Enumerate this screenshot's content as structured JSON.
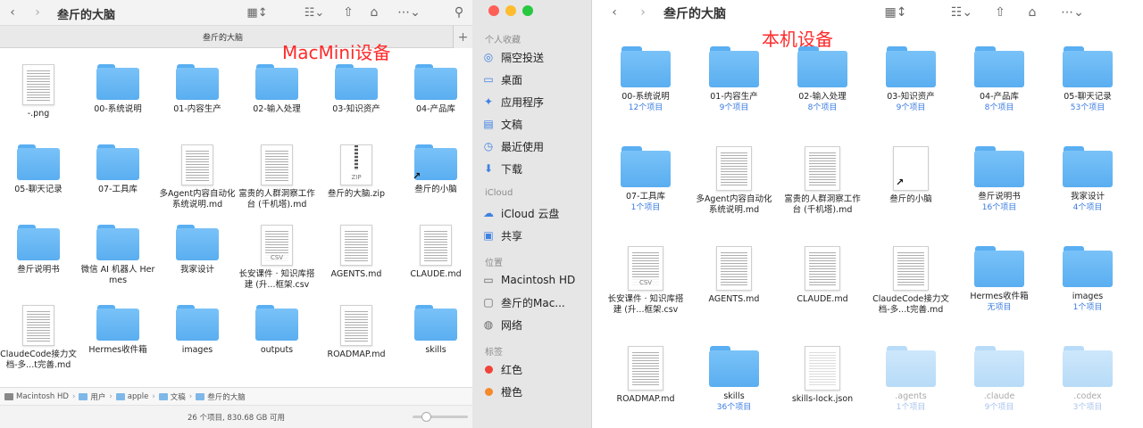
{
  "left_window": {
    "title": "叁斤的大脑",
    "tab_title": "叁斤的大脑",
    "annotation": "MacMini设备",
    "items": [
      {
        "label": "-.png",
        "kind": "doc"
      },
      {
        "label": "00-系统说明",
        "kind": "folder"
      },
      {
        "label": "01-内容生产",
        "kind": "folder"
      },
      {
        "label": "02-输入处理",
        "kind": "folder"
      },
      {
        "label": "03-知识资产",
        "kind": "folder"
      },
      {
        "label": "04-产品库",
        "kind": "folder"
      },
      {
        "label": "05-聊天记录",
        "kind": "folder"
      },
      {
        "label": "07-工具库",
        "kind": "folder"
      },
      {
        "label": "多Agent内容自动化系统说明.md",
        "kind": "doc"
      },
      {
        "label": "富贵的人群洞察工作台 (千机塔).md",
        "kind": "doc"
      },
      {
        "label": "叁斤的大脑.zip",
        "kind": "zip",
        "badge": "ZIP"
      },
      {
        "label": "叁斤的小脑",
        "kind": "alias-folder"
      },
      {
        "label": "叁斤说明书",
        "kind": "folder"
      },
      {
        "label": "微信 AI 机器人 Hermes",
        "kind": "folder"
      },
      {
        "label": "我家设计",
        "kind": "folder"
      },
      {
        "label": "长安课件 · 知识库搭建 (升...框架.csv",
        "kind": "csv",
        "badge": "CSV"
      },
      {
        "label": "AGENTS.md",
        "kind": "doc"
      },
      {
        "label": "CLAUDE.md",
        "kind": "doc"
      },
      {
        "label": "ClaudeCode接力文档-多...t完善.md",
        "kind": "doc"
      },
      {
        "label": "Hermes收件箱",
        "kind": "folder"
      },
      {
        "label": "images",
        "kind": "folder"
      },
      {
        "label": "outputs",
        "kind": "folder"
      },
      {
        "label": "ROADMAP.md",
        "kind": "doc"
      },
      {
        "label": "skills",
        "kind": "folder"
      }
    ],
    "path": [
      "Macintosh HD",
      "用户",
      "apple",
      "文稿",
      "叁斤的大脑"
    ],
    "status": "26 个项目, 830.68 GB 可用"
  },
  "sidebar": {
    "sections": [
      {
        "title": "个人收藏",
        "items": [
          {
            "label": "隔空投送",
            "icon": "airdrop-icon"
          },
          {
            "label": "桌面",
            "icon": "desktop-icon"
          },
          {
            "label": "应用程序",
            "icon": "applications-icon"
          },
          {
            "label": "文稿",
            "icon": "document-icon"
          },
          {
            "label": "最近使用",
            "icon": "clock-icon"
          },
          {
            "label": "下载",
            "icon": "download-icon"
          }
        ]
      },
      {
        "title": "iCloud",
        "items": [
          {
            "label": "iCloud 云盘",
            "icon": "cloud-icon"
          },
          {
            "label": "共享",
            "icon": "shared-folder-icon"
          }
        ]
      },
      {
        "title": "位置",
        "items": [
          {
            "label": "Macintosh HD",
            "icon": "disk-icon"
          },
          {
            "label": "叁斤的Mac...",
            "icon": "display-icon"
          },
          {
            "label": "网络",
            "icon": "network-icon"
          }
        ]
      },
      {
        "title": "标签",
        "items": [
          {
            "label": "红色",
            "icon": "tag-dot-icon",
            "color": "#f0433a"
          },
          {
            "label": "橙色",
            "icon": "tag-dot-icon",
            "color": "#f5892b"
          }
        ]
      }
    ]
  },
  "right_window": {
    "title": "叁斤的大脑",
    "annotation": "本机设备",
    "items": [
      {
        "label": "00-系统说明",
        "sub": "12个项目",
        "kind": "folder"
      },
      {
        "label": "01-内容生产",
        "sub": "9个项目",
        "kind": "folder"
      },
      {
        "label": "02-输入处理",
        "sub": "8个项目",
        "kind": "folder"
      },
      {
        "label": "03-知识资产",
        "sub": "9个项目",
        "kind": "folder"
      },
      {
        "label": "04-产品库",
        "sub": "8个项目",
        "kind": "folder"
      },
      {
        "label": "05-聊天记录",
        "sub": "53个项目",
        "kind": "folder"
      },
      {
        "label": "07-工具库",
        "sub": "1个项目",
        "kind": "folder"
      },
      {
        "label": "多Agent内容自动化系统说明.md",
        "sub": "",
        "kind": "doc"
      },
      {
        "label": "富贵的人群洞察工作台 (千机塔).md",
        "sub": "",
        "kind": "doc"
      },
      {
        "label": "叁斤的小脑",
        "sub": "",
        "kind": "alias-blank"
      },
      {
        "label": "叁斤说明书",
        "sub": "16个项目",
        "kind": "folder"
      },
      {
        "label": "我家设计",
        "sub": "4个项目",
        "kind": "folder"
      },
      {
        "label": "长安课件 · 知识库搭建 (升...框架.csv",
        "sub": "",
        "kind": "csv",
        "badge": "CSV"
      },
      {
        "label": "AGENTS.md",
        "sub": "",
        "kind": "doc"
      },
      {
        "label": "CLAUDE.md",
        "sub": "",
        "kind": "doc"
      },
      {
        "label": "ClaudeCode接力文档-多...t完善.md",
        "sub": "",
        "kind": "doc"
      },
      {
        "label": "Hermes收件箱",
        "sub": "无项目",
        "kind": "folder"
      },
      {
        "label": "images",
        "sub": "1个项目",
        "kind": "folder"
      },
      {
        "label": "ROADMAP.md",
        "sub": "",
        "kind": "doc"
      },
      {
        "label": "skills",
        "sub": "36个项目",
        "kind": "folder"
      },
      {
        "label": "skills-lock.json",
        "sub": "",
        "kind": "blank"
      },
      {
        "label": ".agents",
        "sub": "1个项目",
        "kind": "folder-dim"
      },
      {
        "label": ".claude",
        "sub": "9个项目",
        "kind": "folder-dim"
      },
      {
        "label": ".codex",
        "sub": "3个项目",
        "kind": "folder-dim"
      }
    ]
  },
  "colors": {
    "accent_link": "#3a7be0",
    "annotation_red": "#ff2a2a",
    "folder_blue": "#5aaef0",
    "traffic_red": "#fe5f57",
    "traffic_yellow": "#febc2e",
    "traffic_green": "#28c840"
  }
}
